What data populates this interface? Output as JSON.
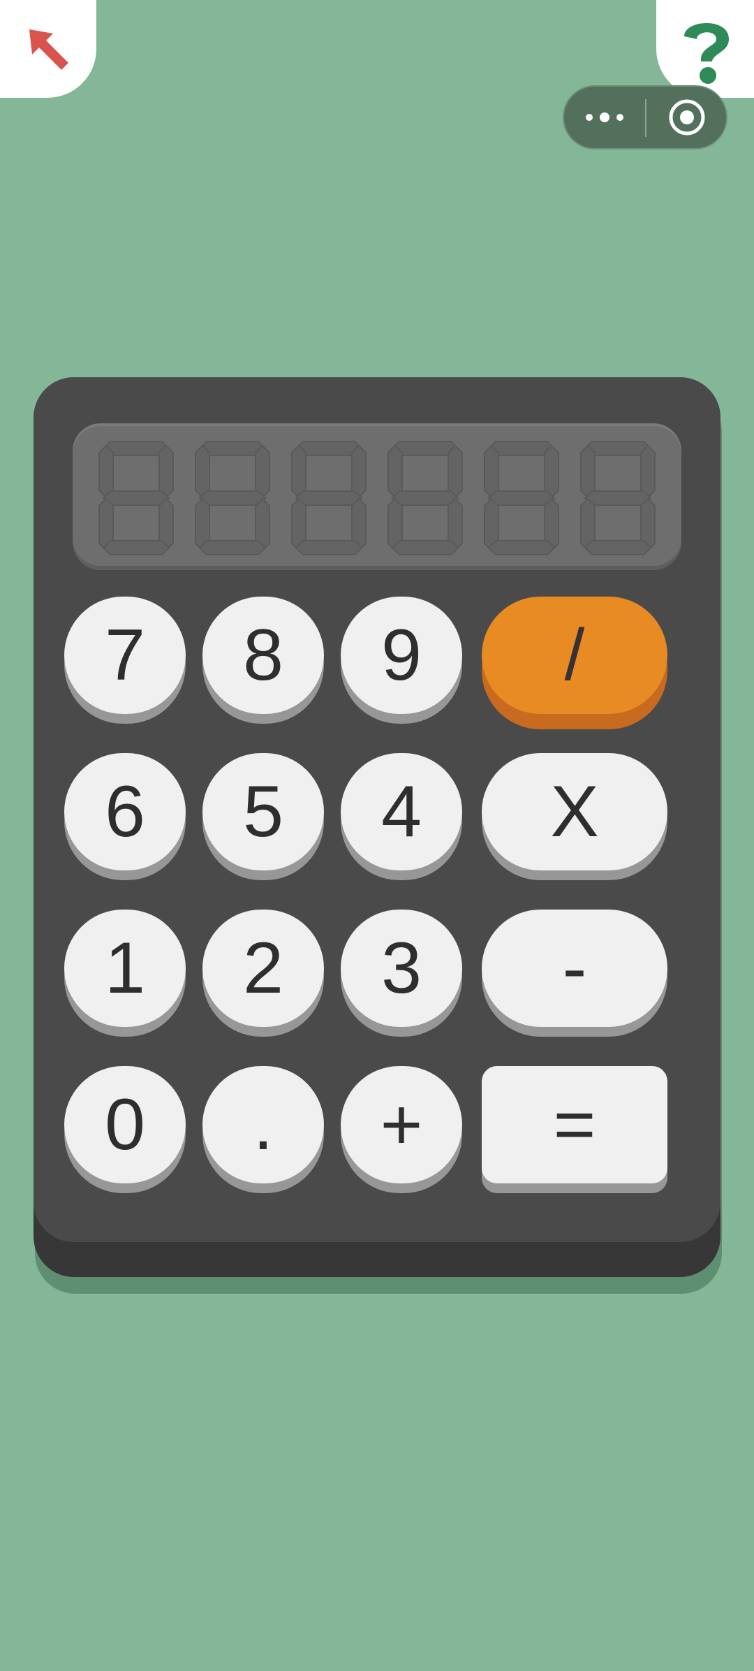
{
  "colors": {
    "background": "#83b798",
    "calculator_body": "#4a4a4a",
    "display": "#6e6e6e",
    "key": "#f0f0f0",
    "operator_accent": "#e78b22"
  },
  "corner_left": {
    "icon": "back-arrow-icon"
  },
  "corner_right": {
    "icon": "question-mark-icon"
  },
  "capsule": {
    "more_icon": "ellipsis-icon",
    "close_icon": "target-circle-icon"
  },
  "display": {
    "digits_shown": 6,
    "value": ""
  },
  "keys": {
    "k7": "7",
    "k8": "8",
    "k9": "9",
    "divide": "/",
    "k6": "6",
    "k5": "5",
    "k4": "4",
    "multiply": "X",
    "k1": "1",
    "k2": "2",
    "k3": "3",
    "subtract": "-",
    "k0": "0",
    "dot": ".",
    "add": "+",
    "equals": "="
  }
}
